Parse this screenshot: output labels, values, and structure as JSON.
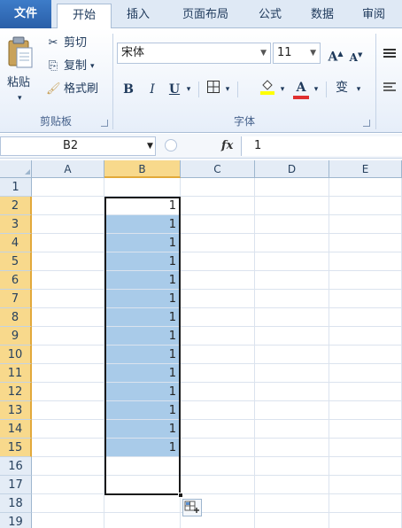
{
  "tabs": [
    "文件",
    "开始",
    "插入",
    "页面布局",
    "公式",
    "数据",
    "审阅"
  ],
  "clipboard": {
    "paste_label": "粘贴",
    "cut_label": "剪切",
    "copy_label": "复制",
    "format_painter_label": "格式刷",
    "group_title": "剪贴板"
  },
  "font": {
    "name": "宋体",
    "size": "11",
    "grow_label": "A",
    "shrink_label": "A",
    "bold": "B",
    "italic": "I",
    "underline": "U",
    "font_color_label": "A",
    "phonetic_label": "变",
    "group_title": "字体"
  },
  "formula_bar": {
    "name_box": "B2",
    "fx": "fx",
    "content": "1"
  },
  "columns": [
    "A",
    "B",
    "C",
    "D",
    "E"
  ],
  "rows": [
    "1",
    "2",
    "3",
    "4",
    "5",
    "6",
    "7",
    "8",
    "9",
    "10",
    "11",
    "12",
    "13",
    "14",
    "15",
    "16",
    "17",
    "18",
    "19"
  ],
  "b_values": [
    "1",
    "1",
    "1",
    "1",
    "1",
    "1",
    "1",
    "1",
    "1",
    "1",
    "1",
    "1",
    "1",
    "1"
  ],
  "colors": {
    "selection_fill": "#a9cbe9",
    "header_highlight": "#f8d98c",
    "tab_file": "#2a5fa8"
  },
  "icons": [
    "paste-icon",
    "cut-icon",
    "copy-icon",
    "format-painter-icon",
    "border-icon",
    "fill-color-icon",
    "font-color-icon",
    "phonetic-icon",
    "align-icon",
    "autofill-options-icon"
  ]
}
